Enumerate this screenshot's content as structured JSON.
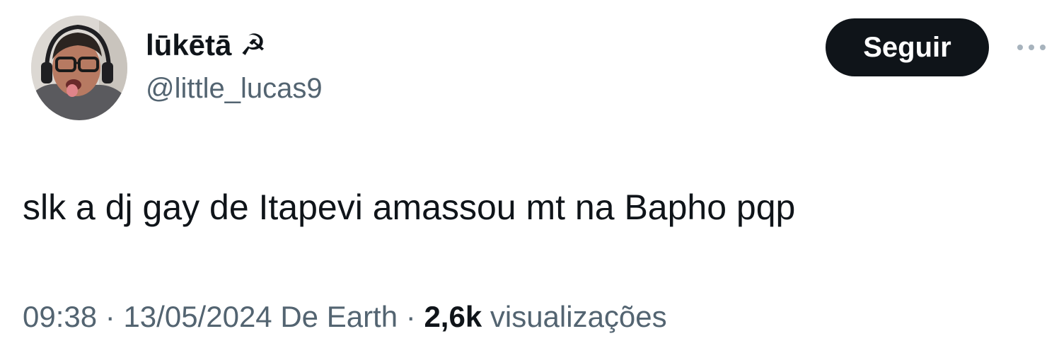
{
  "tweet": {
    "author": {
      "display_name": "lūkētā ☭",
      "handle": "@little_lucas9",
      "avatar_icon": "profile-photo"
    },
    "follow_label": "Seguir",
    "more_icon": "more-dots-icon",
    "text": "slk a dj gay de Itapevi amassou mt na Bapho pqp",
    "meta": {
      "time": "09:38",
      "date": "13/05/2024",
      "source": "De Earth",
      "separator": "·",
      "views_count": "2,6k",
      "views_label": "visualizações"
    }
  },
  "colors": {
    "text_primary": "#0f1419",
    "text_secondary": "#536471",
    "button_bg": "#0f1419",
    "button_text": "#ffffff"
  }
}
